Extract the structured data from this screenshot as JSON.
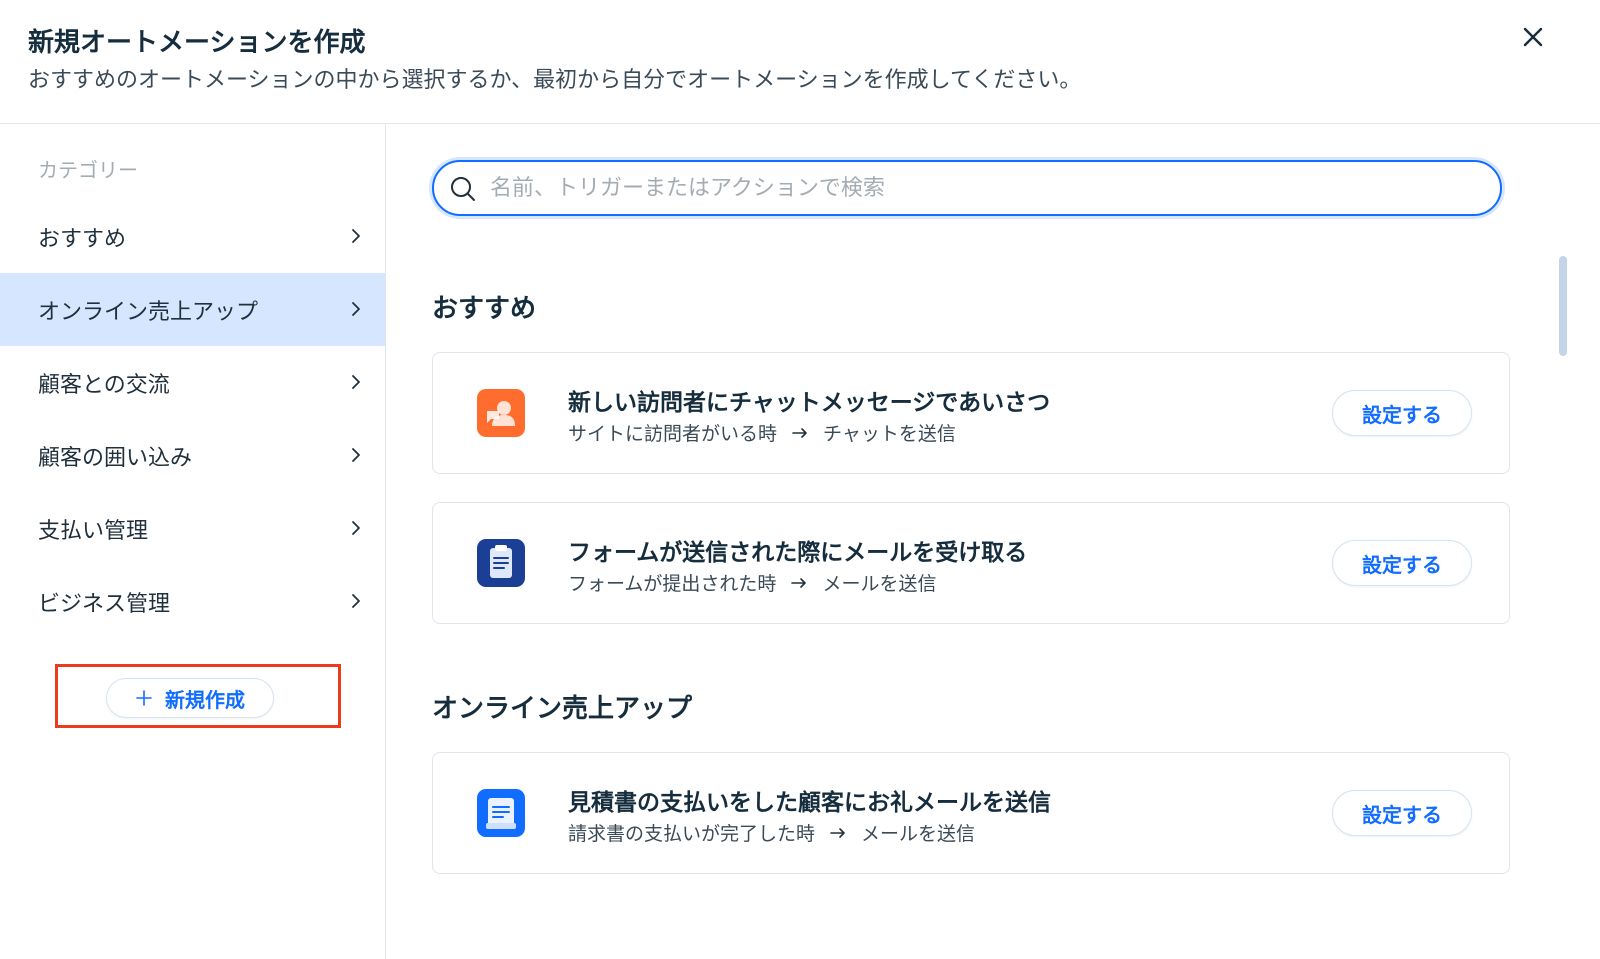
{
  "header": {
    "title": "新規オートメーションを作成",
    "subtitle": "おすすめのオートメーションの中から選択するか、最初から自分でオートメーションを作成してください。",
    "close_icon": "close-icon"
  },
  "sidebar": {
    "heading": "カテゴリー",
    "items": [
      {
        "label": "おすすめ",
        "active": false
      },
      {
        "label": "オンライン売上アップ",
        "active": true
      },
      {
        "label": "顧客との交流",
        "active": false
      },
      {
        "label": "顧客の囲い込み",
        "active": false
      },
      {
        "label": "支払い管理",
        "active": false
      },
      {
        "label": "ビジネス管理",
        "active": false
      }
    ],
    "new_button_label": "新規作成"
  },
  "search": {
    "placeholder": "名前、トリガーまたはアクションで検索",
    "value": ""
  },
  "sections": [
    {
      "title": "おすすめ",
      "cards": [
        {
          "icon": "chat-person-icon",
          "icon_color": "#ff6d2e",
          "title": "新しい訪問者にチャットメッセージであいさつ",
          "trigger": "サイトに訪問者がいる時",
          "action": "チャットを送信",
          "button": "設定する"
        },
        {
          "icon": "form-clipboard-icon",
          "icon_color": "#1c3f96",
          "title": "フォームが送信された際にメールを受け取る",
          "trigger": "フォームが提出された時",
          "action": "メールを送信",
          "button": "設定する"
        }
      ]
    },
    {
      "title": "オンライン売上アップ",
      "cards": [
        {
          "icon": "invoice-document-icon",
          "icon_color": "#116dff",
          "title": "見積書の支払いをした顧客にお礼メールを送信",
          "trigger": "請求書の支払いが完了した時",
          "action": "メールを送信",
          "button": "設定する"
        }
      ]
    }
  ],
  "colors": {
    "accent": "#116dff",
    "active_bg": "#d6e6fe",
    "highlight_frame": "#ee3b1d"
  }
}
